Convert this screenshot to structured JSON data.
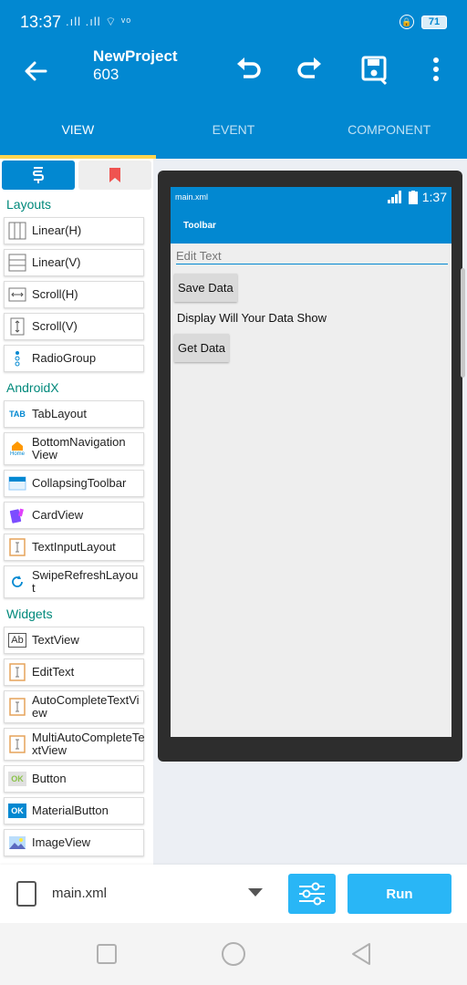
{
  "status_bar": {
    "time": "13:37",
    "signal_text": ".ıll .ıll ⌔ ᵛᵒ",
    "lock_label": "🔒",
    "battery": "71"
  },
  "app_bar": {
    "title": "NewProject",
    "subtitle": "603",
    "icons": [
      "back-arrow-icon",
      "undo-icon",
      "redo-icon",
      "save-icon",
      "more-vert-icon"
    ]
  },
  "tabs": [
    {
      "label": "VIEW",
      "active": true
    },
    {
      "label": "EVENT",
      "active": false
    },
    {
      "label": "COMPONENT",
      "active": false
    }
  ],
  "palette": {
    "sections": [
      {
        "title": "Layouts"
      },
      {
        "title": "AndroidX"
      },
      {
        "title": "Widgets"
      }
    ],
    "layouts": [
      "Linear(H)",
      "Linear(V)",
      "Scroll(H)",
      "Scroll(V)",
      "RadioGroup"
    ],
    "androidx": [
      "TabLayout",
      "BottomNavigation View",
      "CollapsingToolbar",
      "CardView",
      "TextInputLayout",
      "SwipeRefreshLayou t"
    ],
    "widgets": [
      "TextView",
      "EditText",
      "AutoCompleteTextVi ew",
      "MultiAutoCompleteTe xtView",
      "Button",
      "MaterialButton",
      "ImageView"
    ],
    "icon_labels": {
      "tab": "TAB",
      "home": "Home",
      "ab": "Ab",
      "ok": "OK"
    }
  },
  "preview": {
    "status_file": "main.xml",
    "status_time": "1:37",
    "toolbar": "Toolbar",
    "edit_text": "Edit Text",
    "button1": "Save Data",
    "text": "Display Will Your Data Show",
    "button2": "Get Data"
  },
  "bottom_bar": {
    "file_name": "main.xml",
    "run_label": "Run"
  },
  "colors": {
    "primary": "#0288d1",
    "accent": "#29b6f6",
    "tab_indicator": "#ffd54f",
    "section_title": "#00897b"
  }
}
